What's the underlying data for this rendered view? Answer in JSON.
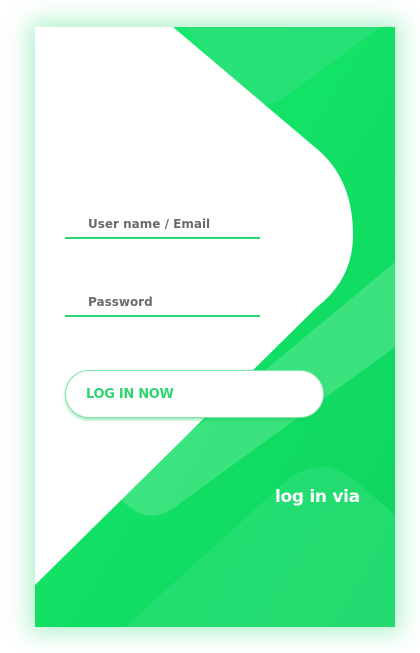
{
  "form": {
    "username_placeholder": "User name / Email",
    "username_value": "",
    "password_placeholder": "Password",
    "password_value": "",
    "login_button": "LOG IN NOW",
    "login_via": "log in via"
  },
  "colors": {
    "accent": "#1ed86c",
    "field_underline": "#26d873",
    "button_text": "#2dd46f"
  }
}
